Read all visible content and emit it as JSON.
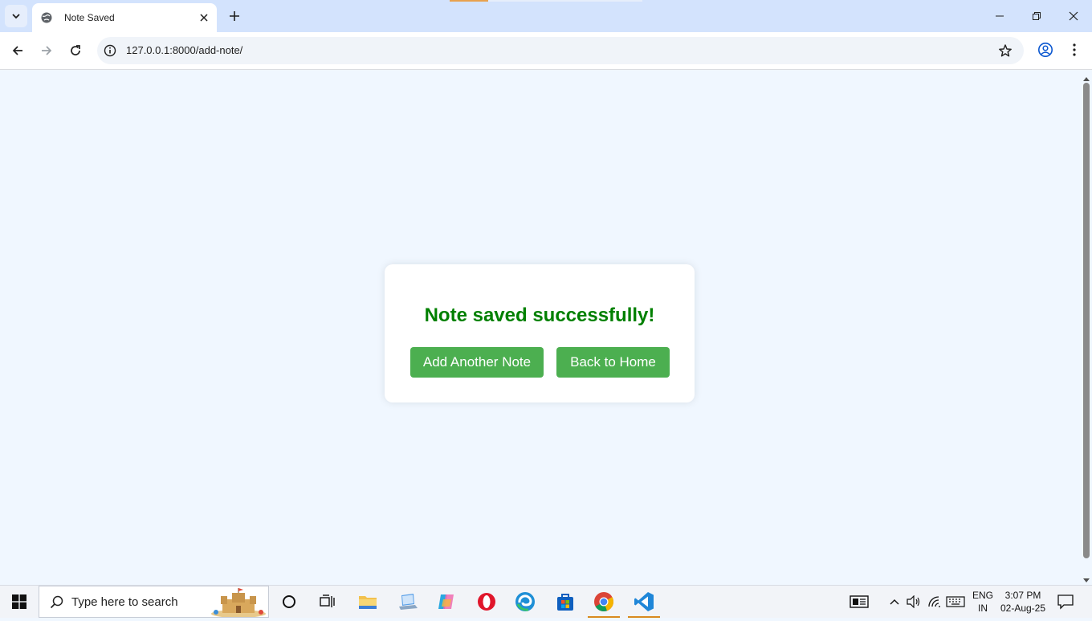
{
  "browser": {
    "tab_title": "Note Saved",
    "url": "127.0.0.1:8000/add-note/"
  },
  "page": {
    "message": "Note saved successfully!",
    "add_button": "Add Another Note",
    "home_button": "Back to Home",
    "message_color": "#008000",
    "button_color": "#4caf50"
  },
  "taskbar": {
    "search_placeholder": "Type here to search",
    "lang_top": "ENG",
    "lang_bottom": "IN",
    "time": "3:07 PM",
    "date": "02-Aug-25"
  }
}
